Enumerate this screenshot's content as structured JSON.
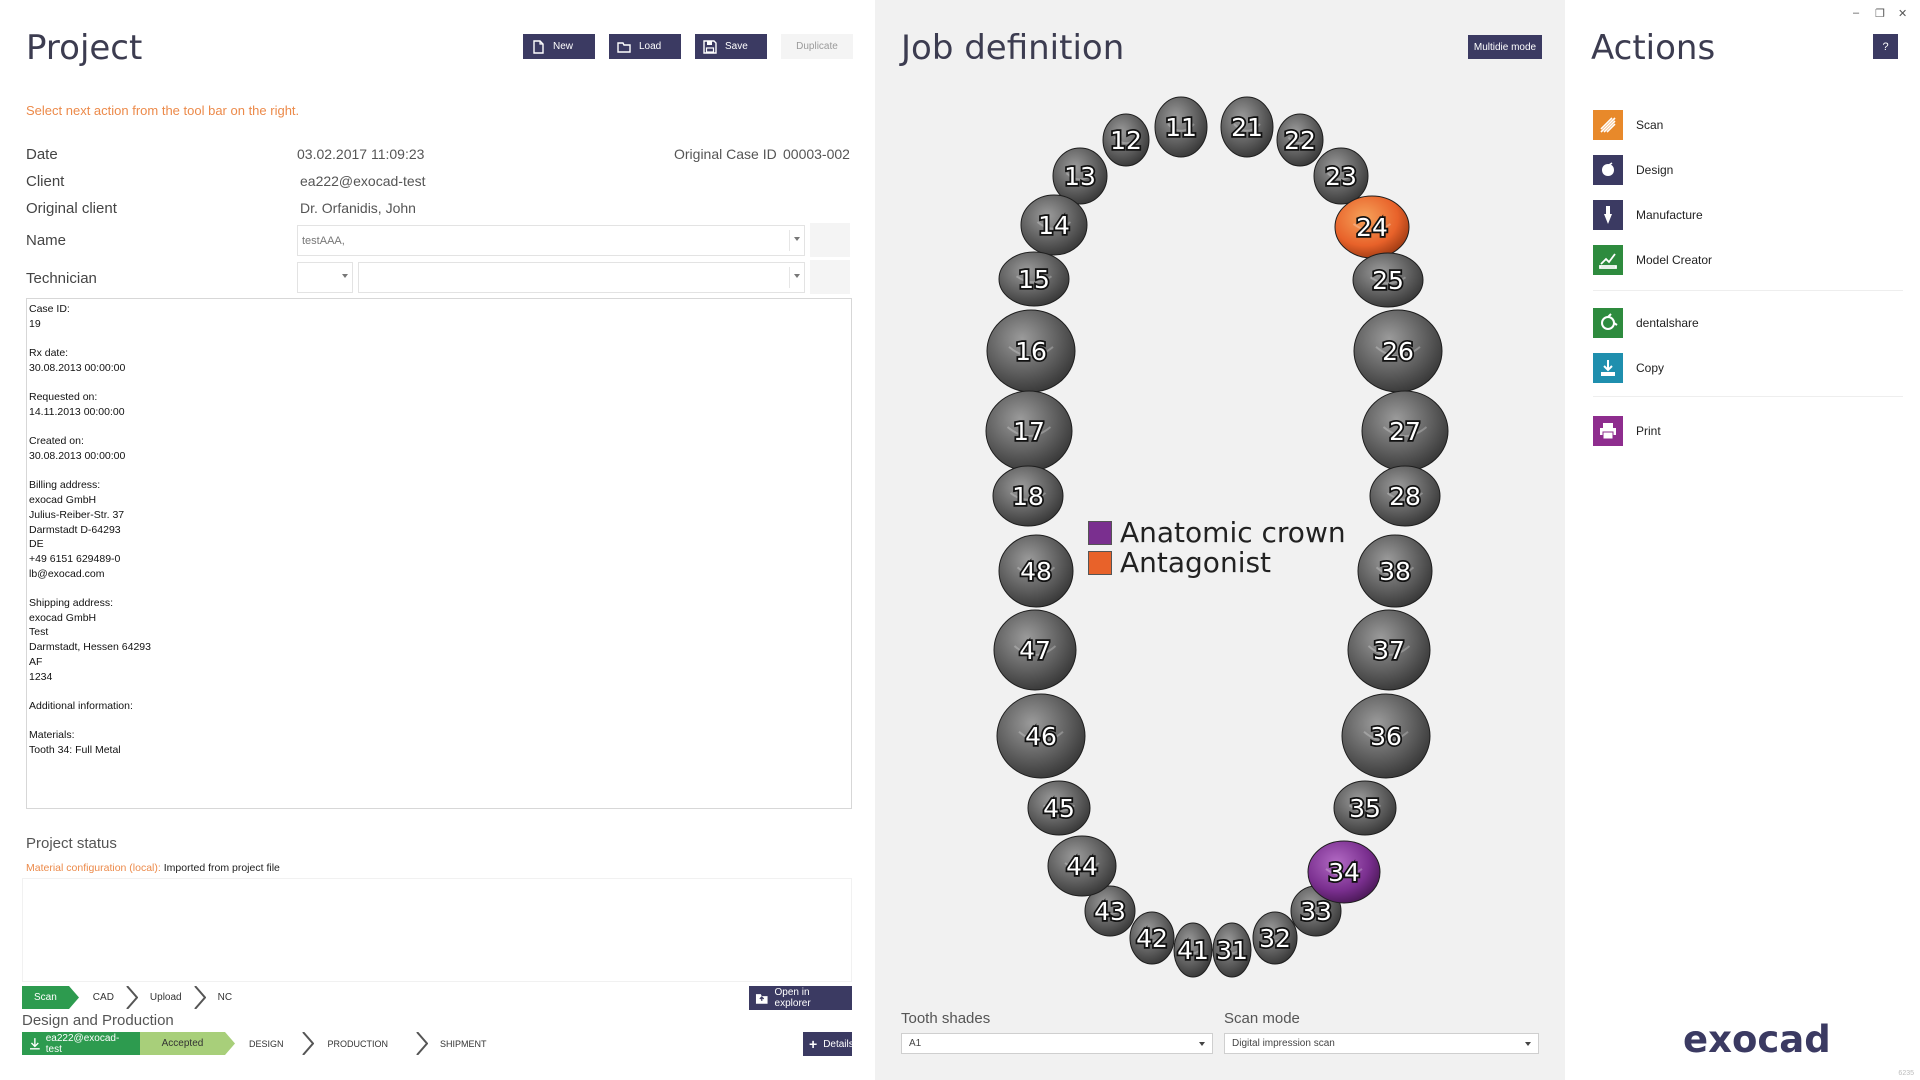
{
  "project": {
    "title": "Project",
    "toolbar": {
      "new_label": "New",
      "load_label": "Load",
      "save_label": "Save",
      "duplicate_label": "Duplicate"
    },
    "hint": "Select next action from the tool bar on the right.",
    "date_label": "Date",
    "date_value": "03.02.2017  11:09:23",
    "orig_case_label": "Original Case ID",
    "orig_case_value": "00003-002",
    "client_label": "Client",
    "client_value": "ea222@exocad-test",
    "orig_client_label": "Original client",
    "orig_client_value": "Dr. Orfanidis, John",
    "name_label": "Name",
    "name_value": "testAAA,",
    "technician_label": "Technician",
    "notes": "Case ID:\n19\n\nRx date:\n30.08.2013 00:00:00\n\nRequested on:\n14.11.2013 00:00:00\n\nCreated on:\n30.08.2013 00:00:00\n\nBilling address:\nexocad GmbH\nJulius-Reiber-Str. 37\nDarmstadt D-64293\nDE\n+49 6151 629489-0\nlb@exocad.com\n\nShipping address:\nexocad GmbH\nTest\nDarmstadt, Hessen 64293\nAF\n1234\n\nAdditional information:\n\nMaterials:\nTooth 34: Full Metal",
    "status_title": "Project status",
    "material_key": "Material configuration (local):",
    "material_value": "Imported from project file",
    "steps": [
      "Scan",
      "CAD",
      "Upload",
      "NC"
    ],
    "open_explorer_label": "Open in explorer",
    "dp_title": "Design and Production",
    "dp_steps": [
      "ea222@exocad-test",
      "Accepted",
      "DESIGN",
      "PRODUCTION",
      "SHIPMENT"
    ],
    "details_label": "Details"
  },
  "job": {
    "title": "Job definition",
    "multidie_label": "Multidie mode",
    "legend": [
      {
        "label": "Anatomic crown",
        "color": "#7a2f8f"
      },
      {
        "label": "Antagonist",
        "color": "#e8622a"
      }
    ],
    "upper_teeth": [
      "11",
      "12",
      "13",
      "14",
      "15",
      "16",
      "17",
      "18",
      "21",
      "22",
      "23",
      "24",
      "25",
      "26",
      "27",
      "28"
    ],
    "lower_teeth": [
      "31",
      "32",
      "33",
      "34",
      "35",
      "36",
      "37",
      "38",
      "41",
      "42",
      "43",
      "44",
      "45",
      "46",
      "47",
      "48"
    ],
    "crown_teeth": [
      "34"
    ],
    "antagonist_teeth": [
      "24"
    ],
    "tooth_shades_label": "Tooth shades",
    "tooth_shades_value": "A1",
    "scan_mode_label": "Scan mode",
    "scan_mode_value": "Digital impression scan"
  },
  "actions": {
    "title": "Actions",
    "help_label": "?",
    "items": [
      {
        "label": "Scan",
        "icon": "scan-icon",
        "color": "#e8892a"
      },
      {
        "label": "Design",
        "icon": "design-icon",
        "color": "#3b3a62"
      },
      {
        "label": "Manufacture",
        "icon": "manufacture-icon",
        "color": "#3b3a62"
      },
      {
        "label": "Model Creator",
        "icon": "model-creator-icon",
        "color": "#2e8b3e"
      },
      {
        "label": "dentalshare",
        "icon": "dentalshare-icon",
        "color": "#2e8b3e"
      },
      {
        "label": "Copy",
        "icon": "copy-icon",
        "color": "#1f8fae"
      },
      {
        "label": "Print",
        "icon": "print-icon",
        "color": "#8e2d8e"
      }
    ],
    "brand": "exocad",
    "version": "6235"
  },
  "window": {
    "minimize_icon": "minimize-icon",
    "restore_icon": "restore-icon",
    "close_icon": "close-icon"
  }
}
